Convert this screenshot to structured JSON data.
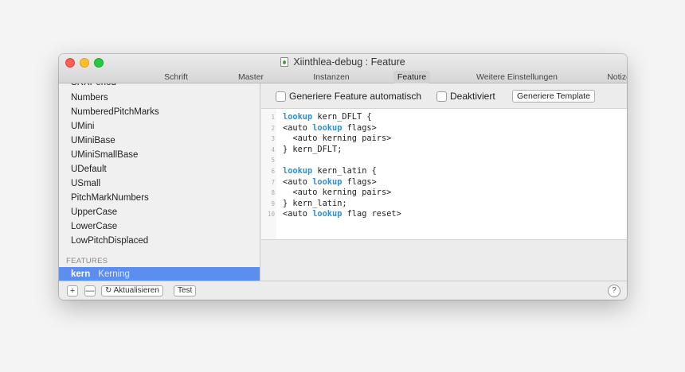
{
  "window": {
    "title": "Xiinthlea-debug : Feature",
    "tabs": [
      "Schrift",
      "Master",
      "Instanzen",
      "Feature",
      "Weitere Einstellungen",
      "Notizen"
    ],
    "active_tab": "Feature"
  },
  "sidebar": {
    "cut_item": "SRXPeriod",
    "items": [
      "Numbers",
      "NumberedPitchMarks",
      "UMini",
      "UMiniBase",
      "UMiniSmallBase",
      "UDefault",
      "USmall",
      "PitchMarkNumbers",
      "UpperCase",
      "LowerCase",
      "LowPitchDisplaced"
    ],
    "features_header": "FEATURES",
    "selected": {
      "tag": "kern",
      "name": "Kerning"
    }
  },
  "toolbar": {
    "auto_generate_label": "Generiere Feature automatisch",
    "disabled_label": "Deaktiviert",
    "generate_template_label": "Generiere Template"
  },
  "editor": {
    "line_numbers": [
      "1",
      "2",
      "3",
      "4",
      "5",
      "6",
      "7",
      "8",
      "9",
      "10"
    ]
  },
  "bottom": {
    "add": "+",
    "remove": "—",
    "refresh_label": "Aktualisieren",
    "test_label": "Test",
    "help": "?"
  }
}
